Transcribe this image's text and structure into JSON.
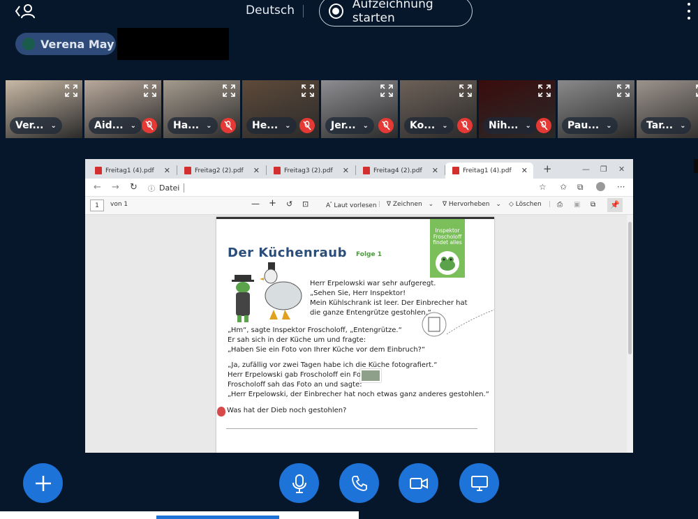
{
  "topbar": {
    "language": "Deutsch",
    "record_label": "Aufzeichnung starten"
  },
  "presenter": {
    "name": "Verena May"
  },
  "participants": [
    {
      "label": "Ver...",
      "muted": false,
      "bg": "#c9b9a6"
    },
    {
      "label": "Aid...",
      "muted": true,
      "bg": "#b9a99c"
    },
    {
      "label": "Ha...",
      "muted": true,
      "bg": "#a59b8e"
    },
    {
      "label": "He...",
      "muted": true,
      "bg": "#5e4a3a"
    },
    {
      "label": "Jer...",
      "muted": true,
      "bg": "#8e8e92"
    },
    {
      "label": "Ko...",
      "muted": true,
      "bg": "#6d6158"
    },
    {
      "label": "Nih...",
      "muted": true,
      "bg": "#3a0c0c"
    },
    {
      "label": "Pau...",
      "muted": false,
      "bg": "#8a8a8a",
      "active": true
    },
    {
      "label": "Tar...",
      "muted": false,
      "bg": "#9c938c"
    }
  ],
  "browser": {
    "tabs": [
      {
        "label": "Freitag1 (4).pdf",
        "active": false
      },
      {
        "label": "Freitag2 (2).pdf",
        "active": false
      },
      {
        "label": "Freitag3 (2).pdf",
        "active": false
      },
      {
        "label": "Freitag4 (2).pdf",
        "active": false
      },
      {
        "label": "Freitag1 (4).pdf",
        "active": true
      }
    ],
    "address": "Datei",
    "page_number": "1",
    "page_of": "von 1",
    "toolbar": {
      "read_aloud": "Laut vorlesen",
      "draw": "Zeichnen",
      "highlight": "Hervorheben",
      "erase": "Löschen"
    }
  },
  "document": {
    "title": "Der Küchenraub",
    "episode": "Folge 1",
    "badge": "Inspektor Froscholoff findet alles",
    "para1": [
      "Herr Erpelowski war sehr aufgeregt.",
      "„Sehen Sie, Herr Inspektor!",
      "Mein Kühlschrank ist leer. Der Einbrecher hat",
      "die ganze Entengrütze gestohlen.“"
    ],
    "para2": [
      "„Hm“, sagte Inspektor Froscholoff, „Entengrütze.“",
      "Er sah sich in der Küche um und fragte:",
      "„Haben Sie ein Foto von Ihrer Küche vor dem Einbruch?“"
    ],
    "para3": [
      "„Ja, zufällig vor zwei Tagen habe ich die Küche fotografiert.“",
      "Herr Erpelowski gab Froscholoff ein Foto",
      "Froscholoff sah das Foto an und sagte:",
      "„Herr Erpelowski, der Einbrecher hat noch etwas ganz anderes gestohlen.“"
    ],
    "question": "Was hat der Dieb noch gestohlen?"
  }
}
